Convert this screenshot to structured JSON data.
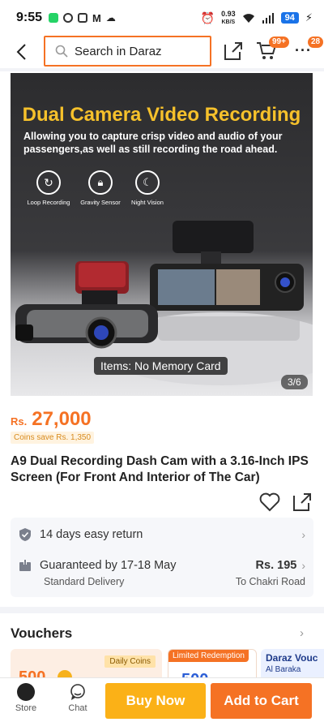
{
  "status_bar": {
    "time": "9:55",
    "net_speed_value": "0.93",
    "net_speed_unit": "KB/S",
    "battery": "94"
  },
  "header": {
    "search_placeholder": "Search in Daraz",
    "cart_badge": "99+",
    "more_badge": "28"
  },
  "gallery": {
    "headline": "Dual Camera Video Recording",
    "subheadline": "Allowing you to capture crisp video and audio of your passengers,as well as still recording the road ahead.",
    "features": [
      "Loop Recording",
      "Gravity Sensor",
      "Night Vision"
    ],
    "variant_label": "Items: No Memory Card",
    "counter": "3/6"
  },
  "product": {
    "currency": "Rs.",
    "price": "27,000",
    "coins_save": "Coins save Rs. 1,350",
    "title": "A9 Dual Recording Dash Cam with a 3.16-Inch IPS Screen (For Front And Interior of The Car)"
  },
  "services": {
    "return_text": "14 days easy return",
    "delivery_guarantee": "Guaranteed by 17-18 May",
    "delivery_type": "Standard Delivery",
    "delivery_fee": "Rs. 195",
    "delivery_location": "To Chakri Road"
  },
  "vouchers": {
    "title": "Vouchers",
    "card1_amount": "500",
    "card1_tag": "Daily Coins",
    "card2_tag": "Limited Redemption",
    "card2_amount": "500",
    "card3_title": "Daraz Vouc",
    "card3_sub": "Al Baraka"
  },
  "bottom_bar": {
    "store_label": "Store",
    "chat_label": "Chat",
    "buy_now": "Buy Now",
    "add_to_cart": "Add to Cart"
  },
  "colors": {
    "accent": "#f57224",
    "buy_now": "#fbb117",
    "banner_title": "#f6c12b"
  }
}
